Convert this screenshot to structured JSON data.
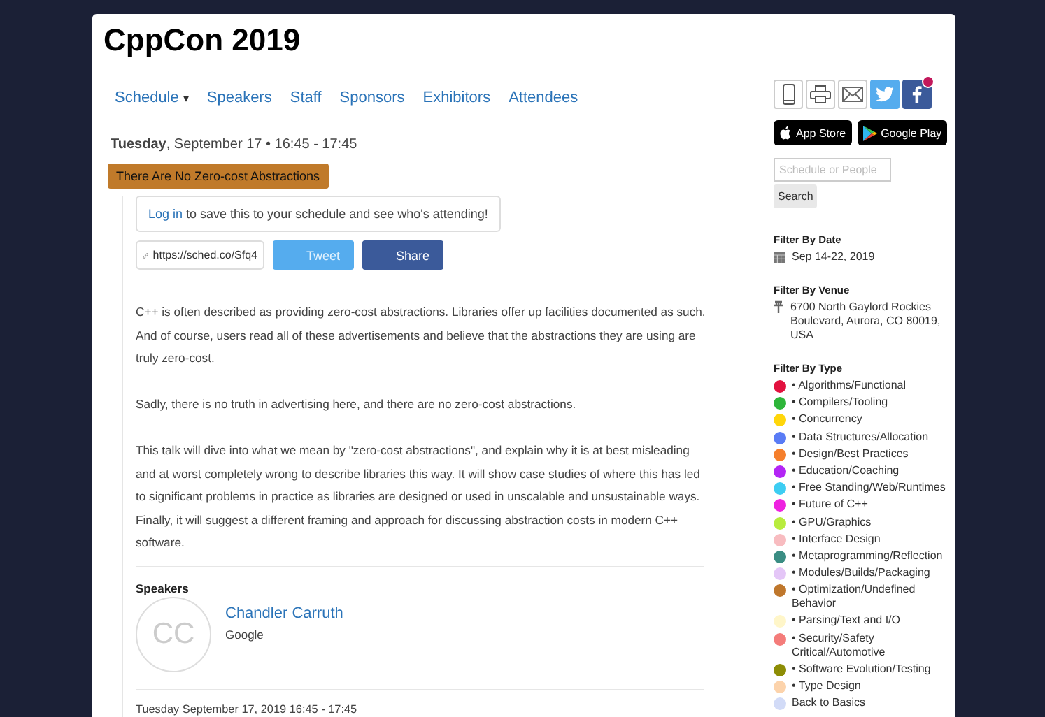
{
  "site_title": "CppCon 2019",
  "nav": [
    {
      "label": "Schedule",
      "caret": "▾"
    },
    {
      "label": "Speakers"
    },
    {
      "label": "Staff"
    },
    {
      "label": "Sponsors"
    },
    {
      "label": "Exhibitors"
    },
    {
      "label": "Attendees"
    }
  ],
  "event": {
    "day": "Tuesday",
    "when": ", September 17 • 16:45 - 17:45",
    "title": "There Are No Zero-cost Abstractions",
    "login_link": "Log in",
    "login_text": " to save this to your schedule and see who's attending!",
    "short_url": "https://sched.co/Sfq4",
    "tweet": "Tweet",
    "share": "Share",
    "description": [
      "C++ is often described as providing zero-cost abstractions. Libraries offer up facilities documented as such. And of course, users read all of these advertisements and believe that the abstractions they are using are truly zero-cost.",
      "Sadly, there is no truth in advertising here, and there are no zero-cost abstractions.",
      "This talk will dive into what we mean by \"zero-cost abstractions\", and explain why it is at best misleading and at worst completely wrong to describe libraries this way. It will show case studies of where this has led to significant problems in practice as libraries are designed or used in unscalable and unsustainable ways. Finally, it will suggest a different framing and approach for discussing abstraction costs in modern C++ software."
    ],
    "speakers_heading": "Speakers",
    "speakers": [
      {
        "initials": "CC",
        "name": "Chandler Carruth",
        "company": "Google"
      }
    ],
    "footer_time": "Tuesday September 17, 2019 16:45 - 17:45"
  },
  "sidebar": {
    "app_store": "App Store",
    "google_play": "Google Play",
    "search_placeholder": "Schedule or People",
    "search_button": "Search",
    "date_heading": "Filter By Date",
    "date": "Sep 14-22, 2019",
    "venue_heading": "Filter By Venue",
    "venue": "6700 North Gaylord Rockies Boulevard, Aurora, CO 80019, USA",
    "type_heading": "Filter By Type",
    "types": [
      {
        "label": "• Algorithms/Functional",
        "color": "#e2123f"
      },
      {
        "label": "• Compilers/Tooling",
        "color": "#2eb53a"
      },
      {
        "label": "• Concurrency",
        "color": "#ffd60a"
      },
      {
        "label": "• Data Structures/Allocation",
        "color": "#5a7cf5"
      },
      {
        "label": "• Design/Best Practices",
        "color": "#f57f2c"
      },
      {
        "label": "• Education/Coaching",
        "color": "#b325f5"
      },
      {
        "label": "• Free Standing/Web/Runtimes",
        "color": "#3dcdf2"
      },
      {
        "label": "• Future of C++",
        "color": "#ee22e0"
      },
      {
        "label": "• GPU/Graphics",
        "color": "#b8ec3e"
      },
      {
        "label": "• Interface Design",
        "color": "#f8bcc0"
      },
      {
        "label": "• Metaprogramming/Reflection",
        "color": "#3a8d83"
      },
      {
        "label": "• Modules/Builds/Packaging",
        "color": "#e4c6f7"
      },
      {
        "label": "• Optimization/Undefined Behavior",
        "color": "#bf772c"
      },
      {
        "label": "• Parsing/Text and I/O",
        "color": "#fff6c9"
      },
      {
        "label": "• Security/Safety Critical/Automotive",
        "color": "#f47c7a"
      },
      {
        "label": "• Software Evolution/Testing",
        "color": "#8d8d05"
      },
      {
        "label": "• Type Design",
        "color": "#fcd3ab"
      },
      {
        "label": "Back to Basics",
        "color": "#d2dbf7"
      }
    ]
  }
}
